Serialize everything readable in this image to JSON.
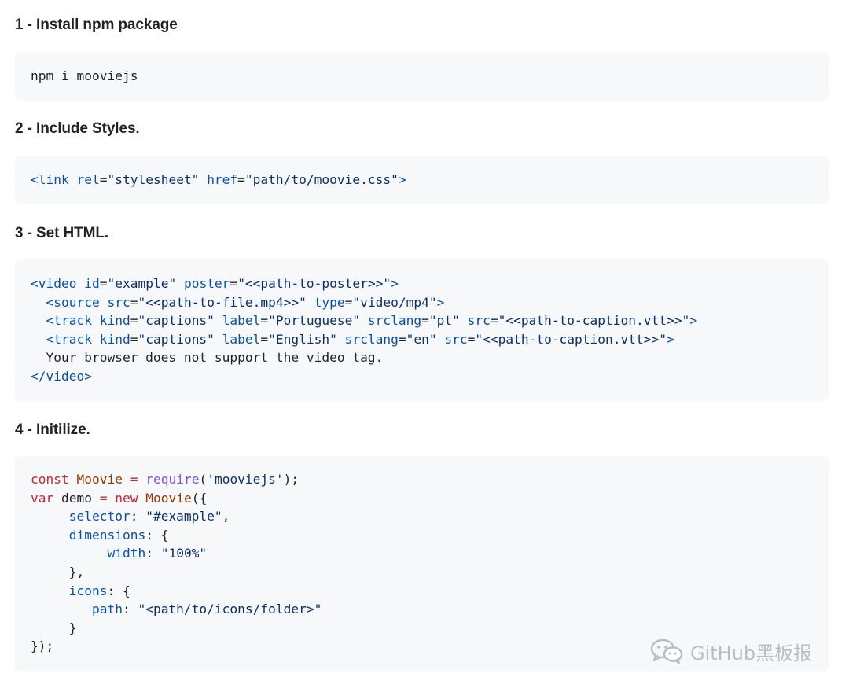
{
  "steps": [
    {
      "heading": "1 - Install npm package"
    },
    {
      "heading": "2 - Include Styles."
    },
    {
      "heading": "3 - Set HTML."
    },
    {
      "heading": "4 - Initilize."
    }
  ],
  "code": {
    "install": "npm i mooviejs",
    "styles": {
      "open": "<link",
      "rel_attr": "rel",
      "eq1": "=",
      "rel_value": "\"stylesheet\"",
      "href_attr": "href",
      "eq2": "=",
      "href_value": "\"path/to/moovie.css\"",
      "close": ">"
    },
    "html": [
      [
        {
          "t": "<video",
          "c": "tag"
        },
        {
          "t": " ",
          "c": "plain"
        },
        {
          "t": "id",
          "c": "attr"
        },
        {
          "t": "=",
          "c": "plain"
        },
        {
          "t": "\"example\"",
          "c": "str"
        },
        {
          "t": " ",
          "c": "plain"
        },
        {
          "t": "poster",
          "c": "attr"
        },
        {
          "t": "=",
          "c": "plain"
        },
        {
          "t": "\"<<path-to-poster>>\"",
          "c": "str"
        },
        {
          "t": ">",
          "c": "tag"
        }
      ],
      [
        {
          "t": "  ",
          "c": "plain"
        },
        {
          "t": "<source",
          "c": "tag"
        },
        {
          "t": " ",
          "c": "plain"
        },
        {
          "t": "src",
          "c": "attr"
        },
        {
          "t": "=",
          "c": "plain"
        },
        {
          "t": "\"<<path-to-file.mp4>>\"",
          "c": "str"
        },
        {
          "t": " ",
          "c": "plain"
        },
        {
          "t": "type",
          "c": "attr"
        },
        {
          "t": "=",
          "c": "plain"
        },
        {
          "t": "\"video/mp4\"",
          "c": "str"
        },
        {
          "t": ">",
          "c": "tag"
        }
      ],
      [
        {
          "t": "  ",
          "c": "plain"
        },
        {
          "t": "<track",
          "c": "tag"
        },
        {
          "t": " ",
          "c": "plain"
        },
        {
          "t": "kind",
          "c": "attr"
        },
        {
          "t": "=",
          "c": "plain"
        },
        {
          "t": "\"captions\"",
          "c": "str"
        },
        {
          "t": " ",
          "c": "plain"
        },
        {
          "t": "label",
          "c": "attr"
        },
        {
          "t": "=",
          "c": "plain"
        },
        {
          "t": "\"Portuguese\"",
          "c": "str"
        },
        {
          "t": " ",
          "c": "plain"
        },
        {
          "t": "srclang",
          "c": "attr"
        },
        {
          "t": "=",
          "c": "plain"
        },
        {
          "t": "\"pt\"",
          "c": "str"
        },
        {
          "t": " ",
          "c": "plain"
        },
        {
          "t": "src",
          "c": "attr"
        },
        {
          "t": "=",
          "c": "plain"
        },
        {
          "t": "\"<<path-to-caption.vtt>>\"",
          "c": "str"
        },
        {
          "t": ">",
          "c": "tag"
        }
      ],
      [
        {
          "t": "  ",
          "c": "plain"
        },
        {
          "t": "<track",
          "c": "tag"
        },
        {
          "t": " ",
          "c": "plain"
        },
        {
          "t": "kind",
          "c": "attr"
        },
        {
          "t": "=",
          "c": "plain"
        },
        {
          "t": "\"captions\"",
          "c": "str"
        },
        {
          "t": " ",
          "c": "plain"
        },
        {
          "t": "label",
          "c": "attr"
        },
        {
          "t": "=",
          "c": "plain"
        },
        {
          "t": "\"English\"",
          "c": "str"
        },
        {
          "t": " ",
          "c": "plain"
        },
        {
          "t": "srclang",
          "c": "attr"
        },
        {
          "t": "=",
          "c": "plain"
        },
        {
          "t": "\"en\"",
          "c": "str"
        },
        {
          "t": " ",
          "c": "plain"
        },
        {
          "t": "src",
          "c": "attr"
        },
        {
          "t": "=",
          "c": "plain"
        },
        {
          "t": "\"<<path-to-caption.vtt>>\"",
          "c": "str"
        },
        {
          "t": ">",
          "c": "tag"
        }
      ],
      [
        {
          "t": "  Your browser does not support the video tag.",
          "c": "plain"
        }
      ],
      [
        {
          "t": "</video",
          "c": "tag"
        },
        {
          "t": ">",
          "c": "tag"
        }
      ]
    ],
    "js": [
      [
        {
          "t": "const",
          "c": "kw"
        },
        {
          "t": " ",
          "c": "plain"
        },
        {
          "t": "Moovie",
          "c": "ent"
        },
        {
          "t": " ",
          "c": "plain"
        },
        {
          "t": "=",
          "c": "kw"
        },
        {
          "t": " ",
          "c": "plain"
        },
        {
          "t": "require",
          "c": "fn"
        },
        {
          "t": "(",
          "c": "plain"
        },
        {
          "t": "'mooviejs'",
          "c": "str"
        },
        {
          "t": ");",
          "c": "plain"
        }
      ],
      [
        {
          "t": "var",
          "c": "kw"
        },
        {
          "t": " demo ",
          "c": "plain"
        },
        {
          "t": "=",
          "c": "kw"
        },
        {
          "t": " ",
          "c": "plain"
        },
        {
          "t": "new",
          "c": "kw"
        },
        {
          "t": " ",
          "c": "plain"
        },
        {
          "t": "Moovie",
          "c": "ent"
        },
        {
          "t": "({",
          "c": "plain"
        }
      ],
      [
        {
          "t": "     ",
          "c": "plain"
        },
        {
          "t": "selector",
          "c": "prop"
        },
        {
          "t": ": ",
          "c": "plain"
        },
        {
          "t": "\"#example\"",
          "c": "str"
        },
        {
          "t": ",",
          "c": "plain"
        }
      ],
      [
        {
          "t": "     ",
          "c": "plain"
        },
        {
          "t": "dimensions",
          "c": "prop"
        },
        {
          "t": ": {",
          "c": "plain"
        }
      ],
      [
        {
          "t": "          ",
          "c": "plain"
        },
        {
          "t": "width",
          "c": "prop"
        },
        {
          "t": ": ",
          "c": "plain"
        },
        {
          "t": "\"100%\"",
          "c": "str"
        }
      ],
      [
        {
          "t": "     },",
          "c": "plain"
        }
      ],
      [
        {
          "t": "     ",
          "c": "plain"
        },
        {
          "t": "icons",
          "c": "prop"
        },
        {
          "t": ": {",
          "c": "plain"
        }
      ],
      [
        {
          "t": "        ",
          "c": "plain"
        },
        {
          "t": "path",
          "c": "prop"
        },
        {
          "t": ": ",
          "c": "plain"
        },
        {
          "t": "\"<path/to/icons/folder>\"",
          "c": "str"
        }
      ],
      [
        {
          "t": "     }",
          "c": "plain"
        }
      ],
      [
        {
          "t": "});",
          "c": "plain"
        }
      ]
    ]
  },
  "watermark": {
    "text": "GitHub黑板报",
    "icon": "wechat-icon"
  },
  "colors": {
    "code_background": "#f6f8fa",
    "tag": "#0550ae",
    "string": "#0a3069",
    "keyword": "#cf222e",
    "function": "#8250df",
    "entity": "#953800"
  }
}
